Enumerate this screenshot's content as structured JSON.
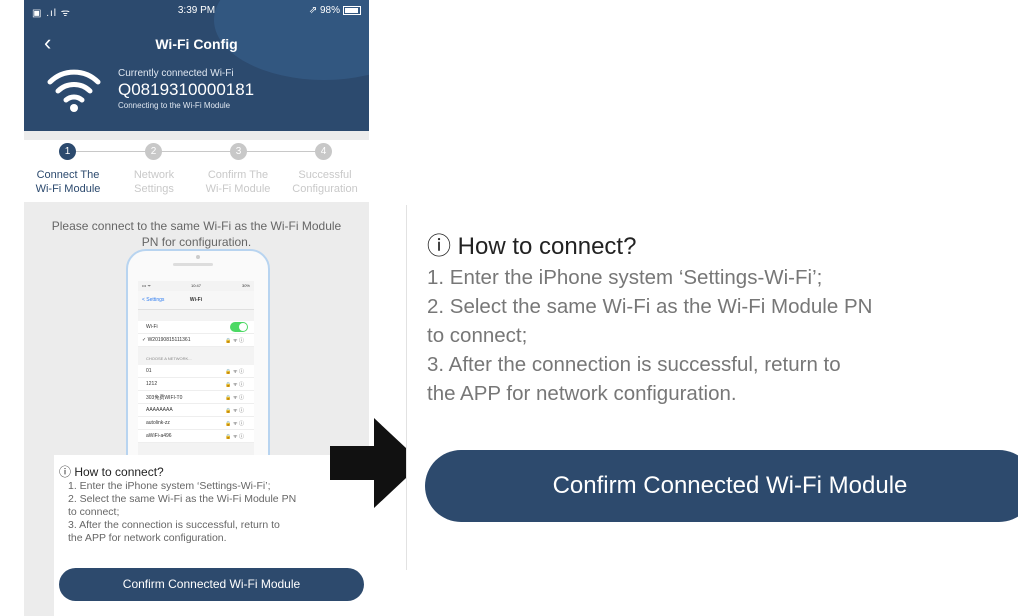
{
  "statusbar": {
    "left": "▣ .ıl ᯤ",
    "time": "3:39 PM",
    "right": "⇗ 98%"
  },
  "header": {
    "back": "‹",
    "title": "Wi-Fi Config",
    "current_label": "Currently connected Wi-Fi",
    "current_ssid": "Q0819310000181",
    "status": "Connecting to the Wi-Fi Module"
  },
  "steps": [
    {
      "num": "1",
      "line1": "Connect The",
      "line2": "Wi-Fi Module",
      "active": true
    },
    {
      "num": "2",
      "line1": "Network",
      "line2": "Settings",
      "active": false
    },
    {
      "num": "3",
      "line1": "Confirm The",
      "line2": "Wi-Fi Module",
      "active": false
    },
    {
      "num": "4",
      "line1": "Successful",
      "line2": "Configuration",
      "active": false
    }
  ],
  "instruction": "Please connect to the same Wi-Fi as the Wi-Fi Module PN for configuration.",
  "mini_phone": {
    "status_left": "•••  ᯤ",
    "status_time": "10:47",
    "status_right": "30%",
    "back": "< Settings",
    "title": "Wi-Fi",
    "wifi_label": "Wi-Fi",
    "connected": "✓  W20190815111361",
    "choose": "CHOOSE A NETWORK...",
    "networks": [
      "01",
      "1212",
      "303免费WIFI-T0",
      "AAAAAAAA",
      "autolink-zz",
      "aWiFi-a496"
    ],
    "net_icons": "🔒 ᯤ ⓘ"
  },
  "popup": {
    "heading": "ⓘ How to connect?",
    "lines": [
      "1. Enter the iPhone system ‘Settings-Wi-Fi’;",
      "2. Select the same Wi-Fi as the Wi-Fi Module PN",
      "to connect;",
      "3. After the connection is successful, return to",
      "the APP for network configuration."
    ],
    "button": "Confirm Connected Wi-Fi Module"
  },
  "zoom": {
    "heading": "ⓘ How to connect?",
    "lines": [
      "1. Enter the iPhone system ‘Settings-Wi-Fi’;",
      "2. Select the same Wi-Fi as the Wi-Fi Module PN",
      "to connect;",
      "3. After the connection is successful, return to",
      "the APP for network configuration."
    ],
    "button": "Confirm Connected Wi-Fi Module"
  },
  "colors": {
    "header": "#2c4a6e",
    "button": "#2d4a6d",
    "toggle": "#4cd964"
  }
}
